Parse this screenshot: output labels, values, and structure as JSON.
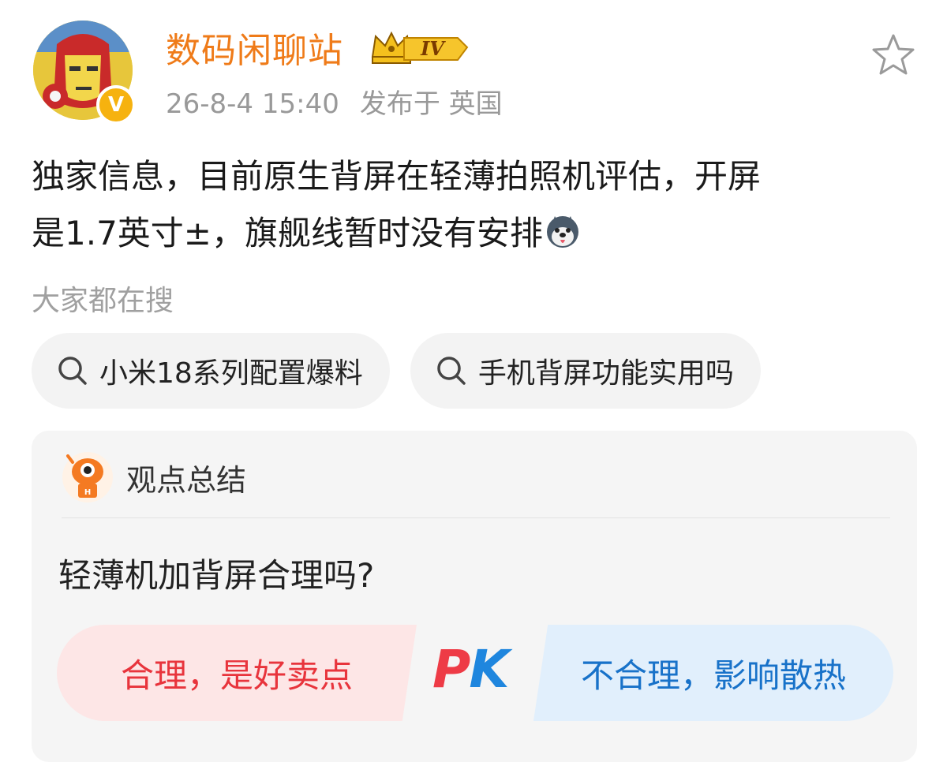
{
  "post": {
    "username": "数码闲聊站",
    "level": "IV",
    "verified_mark": "V",
    "timestamp": "26-8-4 15:40",
    "location": "发布于 英国",
    "text_line1": "独家信息，目前原生背屏在轻薄拍照机评估，开屏",
    "text_line2": "是1.7英寸±，旗舰线暂时没有安排"
  },
  "search": {
    "label": "大家都在搜",
    "chips": [
      {
        "label": "小米18系列配置爆料"
      },
      {
        "label": "手机背屏功能实用吗"
      }
    ]
  },
  "summary": {
    "title": "观点总结",
    "mascot_badge": "H",
    "question": "轻薄机加背屏合理吗?",
    "option_left": "合理，是好卖点",
    "option_right": "不合理，影响散热",
    "pk_p": "P",
    "pk_k": "K"
  },
  "colors": {
    "username": "#ef7b19",
    "verified": "#f6b20f",
    "pk_red": "#ee3b46",
    "pk_blue": "#1f86de",
    "option_left_bg": "#fde6e6",
    "option_right_bg": "#e1effc"
  },
  "icons": [
    "avatar-ironman",
    "verified-badge",
    "crown-level-badge",
    "star-icon",
    "emoji-husky-icon",
    "search-icon",
    "mascot-icon"
  ]
}
